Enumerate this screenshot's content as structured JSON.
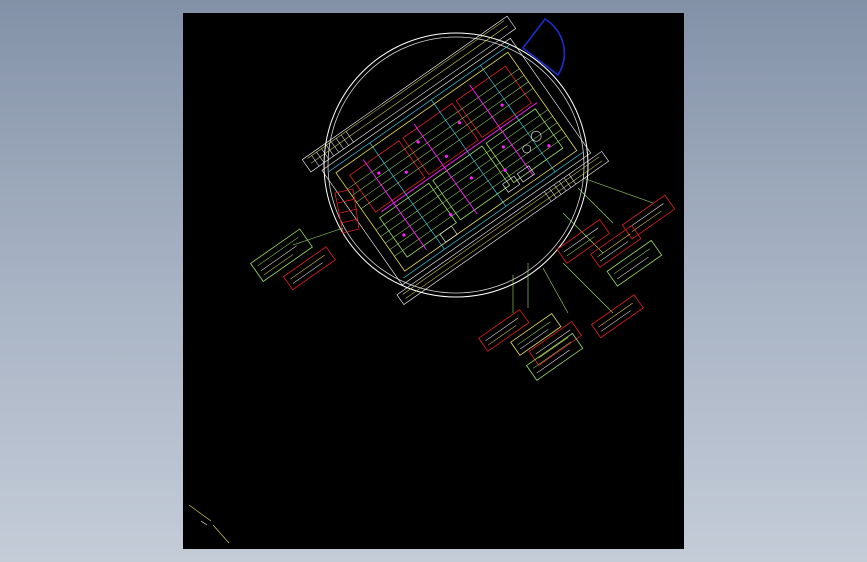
{
  "colors": {
    "viewport_top": "#8391a8",
    "viewport_bottom": "#c4ccd8",
    "sheet": "#000000",
    "outline_white": "#ffffff",
    "line_green": "#9de06a",
    "line_yellow": "#e8e05a",
    "line_red": "#e02020",
    "line_magenta": "#ff20ff",
    "line_cyan": "#40e0ff",
    "line_blue": "#1a2fd0"
  }
}
